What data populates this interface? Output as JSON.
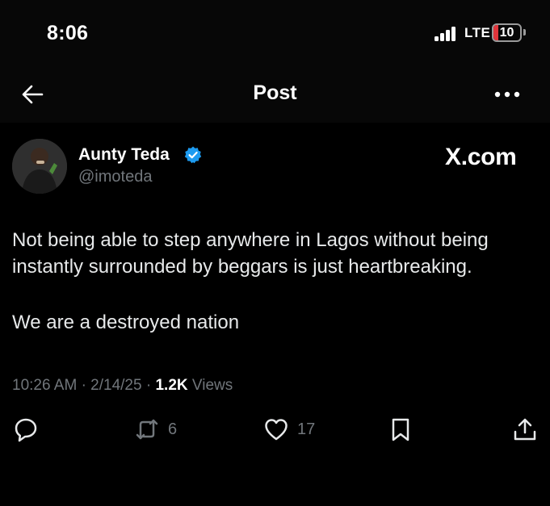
{
  "status_bar": {
    "time": "8:06",
    "network": "LTE",
    "battery_level": "10",
    "battery_fraction": 0.1
  },
  "header": {
    "title": "Post",
    "back_icon": "arrow-left-icon",
    "more_icon": "more-horizontal-icon"
  },
  "post": {
    "author": {
      "name": "Aunty Teda",
      "handle": "@imoteda",
      "verified": true,
      "verified_color": "#1d9bf0"
    },
    "site_label": "X.com",
    "paragraphs": [
      "Not being able to step anywhere in Lagos without being instantly surrounded by beggars is just heartbreaking.",
      "We are a destroyed nation"
    ],
    "time": "10:26 AM",
    "date": "2/14/25",
    "separator": "·",
    "views_count": "1.2K",
    "views_label": "Views"
  },
  "actions": {
    "reply": {
      "icon": "reply-icon",
      "count": ""
    },
    "repost": {
      "icon": "repost-icon",
      "count": "6"
    },
    "like": {
      "icon": "heart-icon",
      "count": "17"
    },
    "bookmark": {
      "icon": "bookmark-icon",
      "count": ""
    },
    "share": {
      "icon": "share-icon",
      "count": ""
    }
  },
  "colors": {
    "background": "#000000",
    "text": "#e7e9ea",
    "secondary": "#71767b",
    "accent": "#1d9bf0",
    "battery_low": "#e0353b"
  }
}
